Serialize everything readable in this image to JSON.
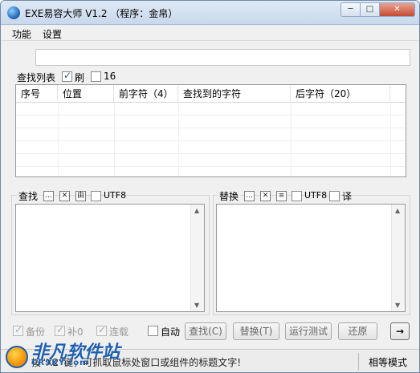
{
  "window": {
    "title": "EXE易容大师 V1.2 （程序：金帛）",
    "min_label": "─",
    "max_label": "□",
    "close_label": "✕"
  },
  "menu": {
    "items": [
      "功能",
      "设置"
    ]
  },
  "search_list": {
    "label": "查找列表",
    "chk_refresh_label": "刷",
    "chk_refresh_checked": true,
    "chk_16_label": "16",
    "chk_16_checked": false
  },
  "listview": {
    "columns": [
      "序号",
      "位置",
      "前字符（4）",
      "查找到的字符",
      "后字符（20）"
    ]
  },
  "find_group": {
    "label": "查找",
    "btn1": "…",
    "btn2": "✕",
    "btn3": "由",
    "utf8_label": "UTF8",
    "utf8_checked": false
  },
  "replace_group": {
    "label": "替换",
    "btn1": "…",
    "btn2": "✕",
    "btn3": "≡",
    "utf8_label": "UTF8",
    "utf8_checked": false,
    "translate_label": "译",
    "translate_checked": false
  },
  "options": {
    "backup_label": "备份",
    "backup_checked": true,
    "pad0_label": "补0",
    "pad0_checked": true,
    "continuous_label": "连载",
    "continuous_checked": true,
    "auto_label": "自动",
    "auto_checked": false
  },
  "buttons": {
    "find": "查找(C)",
    "replace": "替换(T)",
    "test_run": "运行测试",
    "restore": "还原",
    "arrow": "→"
  },
  "status": {
    "hint": "按“X2”键，可抓取鼠标处窗口或组件的标题文字!",
    "mode": "相等模式"
  },
  "watermark": {
    "text": "非凡软件站",
    "sub": "CRSKY.com"
  },
  "colors": {
    "accent": "#1e5fae",
    "close": "#c44a31"
  }
}
